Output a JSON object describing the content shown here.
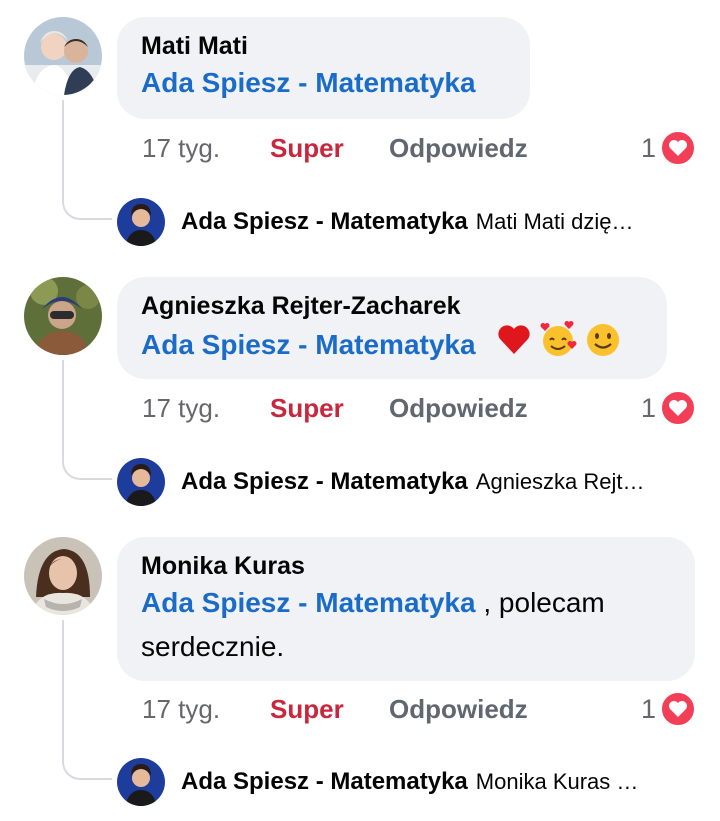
{
  "comments": [
    {
      "author": "Mati Mati",
      "mention": "Ada Spiesz - Matematyka",
      "text_after": "",
      "time": "17 tyg.",
      "super": "Super",
      "reply": "Odpowiedz",
      "reaction_count": "1",
      "reply_preview": {
        "author": "Ada Spiesz - Matematyka",
        "text": "Mati Mati dzię…"
      }
    },
    {
      "author": "Agnieszka Rejter-Zacharek",
      "mention": "Ada Spiesz - Matematyka",
      "text_after": "",
      "emojis": [
        "red-heart",
        "smiling-face-with-hearts",
        "slightly-smiling-face"
      ],
      "time": "17 tyg.",
      "super": "Super",
      "reply": "Odpowiedz",
      "reaction_count": "1",
      "reply_preview": {
        "author": "Ada Spiesz - Matematyka",
        "text": "Agnieszka Rejt…"
      }
    },
    {
      "author": "Monika Kuras",
      "mention": "Ada Spiesz - Matematyka",
      "text_after": ", polecam serdecznie.",
      "time": "17 tyg.",
      "super": "Super",
      "reply": "Odpowiedz",
      "reaction_count": "1",
      "reply_preview": {
        "author": "Ada Spiesz - Matematyka",
        "text": "Monika Kuras …"
      }
    }
  ],
  "colors": {
    "mention": "#1b6cc9",
    "super": "#c8283e",
    "heart": "#f33e58",
    "bubble": "#f0f2f5"
  }
}
